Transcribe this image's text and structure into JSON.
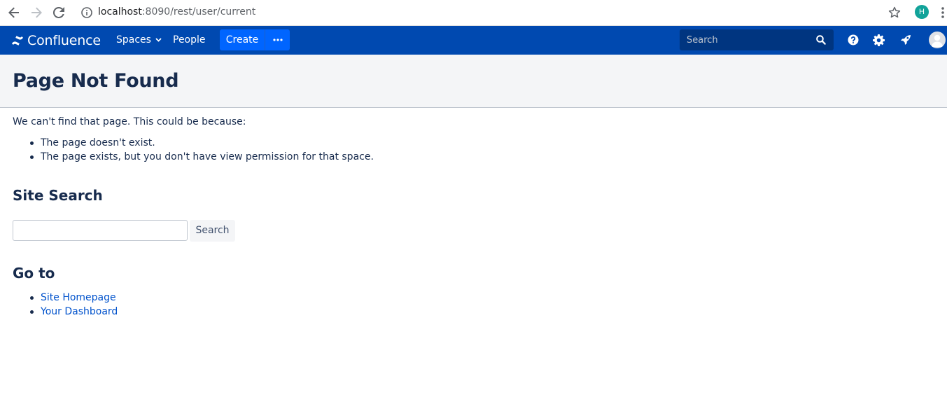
{
  "browser": {
    "url_host": "localhost",
    "url_rest": ":8090/rest/user/current",
    "profile_initial": "H"
  },
  "header": {
    "logo_text": "Confluence",
    "nav": {
      "spaces": "Spaces",
      "people": "People"
    },
    "create_label": "Create",
    "search_placeholder": "Search"
  },
  "page": {
    "title": "Page Not Found",
    "intro": "We can't find that page. This could be because:",
    "reasons": [
      "The page doesn't exist.",
      "The page exists, but you don't have view permission for that space."
    ],
    "site_search": {
      "heading": "Site Search",
      "input_value": "",
      "button_label": "Search"
    },
    "goto": {
      "heading": "Go to",
      "links": [
        "Site Homepage",
        "Your Dashboard"
      ]
    }
  },
  "colors": {
    "header_bg": "#0049b0",
    "create_bg": "#0065ff",
    "search_bg": "#003580",
    "link": "#0052cc",
    "text": "#172b4d",
    "title_band_bg": "#f4f5f7",
    "browser_avatar": "#12a39a"
  },
  "icons": {
    "back": "arrow-left-icon",
    "forward": "arrow-right-icon",
    "reload": "reload-icon",
    "info": "info-icon",
    "bookmark": "star-icon",
    "menu": "kebab-icon",
    "logo": "confluence-logo-icon",
    "spaces_dropdown": "chevron-down-icon",
    "more": "ellipsis-icon",
    "search": "search-icon",
    "help": "help-icon",
    "settings": "gear-icon",
    "notifications": "rocket-icon",
    "avatar": "user-avatar-icon"
  }
}
